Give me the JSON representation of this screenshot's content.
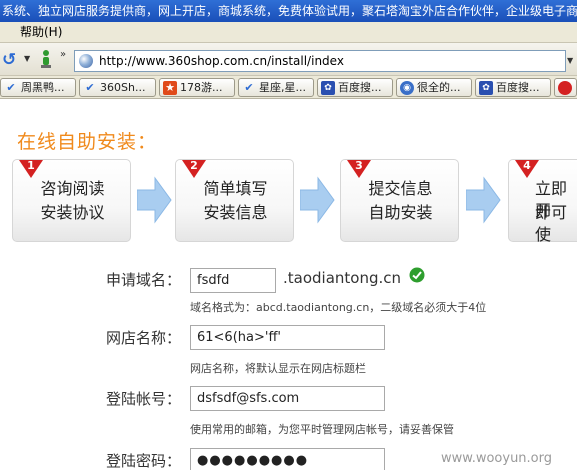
{
  "window": {
    "title": "系统、独立网店服务提供商，网上开店，商城系统，免费体验试用，聚石塔淘宝外店合作伙伴，企业级电子商"
  },
  "menubar": {
    "help_label": "帮助(H)"
  },
  "address_bar": {
    "url": "http://www.360shop.com.cn/install/index"
  },
  "tabs": [
    {
      "label": "周黑鸭...",
      "icon": "check-tab-icon"
    },
    {
      "label": "360Sh...",
      "icon": "check-tab-icon"
    },
    {
      "label": "178游...",
      "icon": "star-tab-icon"
    },
    {
      "label": "星座,星...",
      "icon": "check-tab-icon"
    },
    {
      "label": "百度搜...",
      "icon": "paw-tab-icon"
    },
    {
      "label": "很全的...",
      "icon": "globe-tab-icon"
    },
    {
      "label": "百度搜...",
      "icon": "paw-tab-icon"
    },
    {
      "label": "",
      "icon": "red-circle-tab-icon"
    }
  ],
  "page": {
    "heading": "在线自助安装：",
    "steps": [
      {
        "num": "1",
        "line1": "咨询阅读",
        "line2": "安装协议"
      },
      {
        "num": "2",
        "line1": "简单填写",
        "line2": "安装信息"
      },
      {
        "num": "3",
        "line1": "提交信息",
        "line2": "自助安装"
      },
      {
        "num": "4",
        "line1": "立即开",
        "line2": "即可使"
      }
    ],
    "form": {
      "domain": {
        "label": "申请域名：",
        "value": "fsdfd",
        "suffix": ".taodiantong.cn",
        "hint": "域名格式为：abcd.taodiantong.cn，二级域名必须大于4位"
      },
      "shop_name": {
        "label": "网店名称：",
        "value": "61<6(ha>'ff'",
        "hint": "网店名称，将默认显示在网店标题栏"
      },
      "account": {
        "label": "登陆帐号：",
        "value": "dsfsdf@sfs.com",
        "hint": "使用常用的邮箱，为您平时管理网店帐号，请妥善保管"
      },
      "password": {
        "label": "登陆密码：",
        "value": "●●●●●●●●●"
      }
    }
  },
  "watermark": "www.wooyun.org",
  "colors": {
    "heading": "#f08a1c",
    "badge": "#d42121",
    "arrow": "#a9cdf0",
    "check": "#2e9e2e"
  }
}
